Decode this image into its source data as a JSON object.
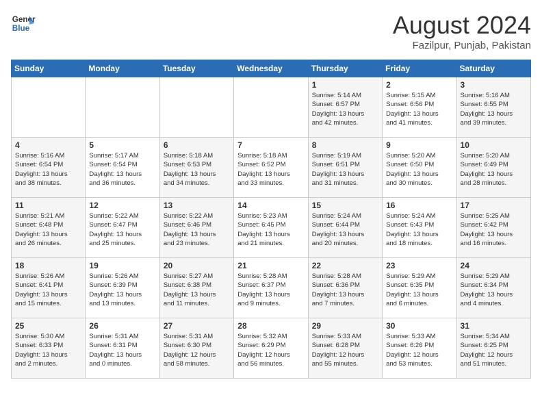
{
  "header": {
    "logo_line1": "General",
    "logo_line2": "Blue",
    "month": "August 2024",
    "location": "Fazilpur, Punjab, Pakistan"
  },
  "weekdays": [
    "Sunday",
    "Monday",
    "Tuesday",
    "Wednesday",
    "Thursday",
    "Friday",
    "Saturday"
  ],
  "weeks": [
    [
      {
        "day": "",
        "text": ""
      },
      {
        "day": "",
        "text": ""
      },
      {
        "day": "",
        "text": ""
      },
      {
        "day": "",
        "text": ""
      },
      {
        "day": "1",
        "text": "Sunrise: 5:14 AM\nSunset: 6:57 PM\nDaylight: 13 hours\nand 42 minutes."
      },
      {
        "day": "2",
        "text": "Sunrise: 5:15 AM\nSunset: 6:56 PM\nDaylight: 13 hours\nand 41 minutes."
      },
      {
        "day": "3",
        "text": "Sunrise: 5:16 AM\nSunset: 6:55 PM\nDaylight: 13 hours\nand 39 minutes."
      }
    ],
    [
      {
        "day": "4",
        "text": "Sunrise: 5:16 AM\nSunset: 6:54 PM\nDaylight: 13 hours\nand 38 minutes."
      },
      {
        "day": "5",
        "text": "Sunrise: 5:17 AM\nSunset: 6:54 PM\nDaylight: 13 hours\nand 36 minutes."
      },
      {
        "day": "6",
        "text": "Sunrise: 5:18 AM\nSunset: 6:53 PM\nDaylight: 13 hours\nand 34 minutes."
      },
      {
        "day": "7",
        "text": "Sunrise: 5:18 AM\nSunset: 6:52 PM\nDaylight: 13 hours\nand 33 minutes."
      },
      {
        "day": "8",
        "text": "Sunrise: 5:19 AM\nSunset: 6:51 PM\nDaylight: 13 hours\nand 31 minutes."
      },
      {
        "day": "9",
        "text": "Sunrise: 5:20 AM\nSunset: 6:50 PM\nDaylight: 13 hours\nand 30 minutes."
      },
      {
        "day": "10",
        "text": "Sunrise: 5:20 AM\nSunset: 6:49 PM\nDaylight: 13 hours\nand 28 minutes."
      }
    ],
    [
      {
        "day": "11",
        "text": "Sunrise: 5:21 AM\nSunset: 6:48 PM\nDaylight: 13 hours\nand 26 minutes."
      },
      {
        "day": "12",
        "text": "Sunrise: 5:22 AM\nSunset: 6:47 PM\nDaylight: 13 hours\nand 25 minutes."
      },
      {
        "day": "13",
        "text": "Sunrise: 5:22 AM\nSunset: 6:46 PM\nDaylight: 13 hours\nand 23 minutes."
      },
      {
        "day": "14",
        "text": "Sunrise: 5:23 AM\nSunset: 6:45 PM\nDaylight: 13 hours\nand 21 minutes."
      },
      {
        "day": "15",
        "text": "Sunrise: 5:24 AM\nSunset: 6:44 PM\nDaylight: 13 hours\nand 20 minutes."
      },
      {
        "day": "16",
        "text": "Sunrise: 5:24 AM\nSunset: 6:43 PM\nDaylight: 13 hours\nand 18 minutes."
      },
      {
        "day": "17",
        "text": "Sunrise: 5:25 AM\nSunset: 6:42 PM\nDaylight: 13 hours\nand 16 minutes."
      }
    ],
    [
      {
        "day": "18",
        "text": "Sunrise: 5:26 AM\nSunset: 6:41 PM\nDaylight: 13 hours\nand 15 minutes."
      },
      {
        "day": "19",
        "text": "Sunrise: 5:26 AM\nSunset: 6:39 PM\nDaylight: 13 hours\nand 13 minutes."
      },
      {
        "day": "20",
        "text": "Sunrise: 5:27 AM\nSunset: 6:38 PM\nDaylight: 13 hours\nand 11 minutes."
      },
      {
        "day": "21",
        "text": "Sunrise: 5:28 AM\nSunset: 6:37 PM\nDaylight: 13 hours\nand 9 minutes."
      },
      {
        "day": "22",
        "text": "Sunrise: 5:28 AM\nSunset: 6:36 PM\nDaylight: 13 hours\nand 7 minutes."
      },
      {
        "day": "23",
        "text": "Sunrise: 5:29 AM\nSunset: 6:35 PM\nDaylight: 13 hours\nand 6 minutes."
      },
      {
        "day": "24",
        "text": "Sunrise: 5:29 AM\nSunset: 6:34 PM\nDaylight: 13 hours\nand 4 minutes."
      }
    ],
    [
      {
        "day": "25",
        "text": "Sunrise: 5:30 AM\nSunset: 6:33 PM\nDaylight: 13 hours\nand 2 minutes."
      },
      {
        "day": "26",
        "text": "Sunrise: 5:31 AM\nSunset: 6:31 PM\nDaylight: 13 hours\nand 0 minutes."
      },
      {
        "day": "27",
        "text": "Sunrise: 5:31 AM\nSunset: 6:30 PM\nDaylight: 12 hours\nand 58 minutes."
      },
      {
        "day": "28",
        "text": "Sunrise: 5:32 AM\nSunset: 6:29 PM\nDaylight: 12 hours\nand 56 minutes."
      },
      {
        "day": "29",
        "text": "Sunrise: 5:33 AM\nSunset: 6:28 PM\nDaylight: 12 hours\nand 55 minutes."
      },
      {
        "day": "30",
        "text": "Sunrise: 5:33 AM\nSunset: 6:26 PM\nDaylight: 12 hours\nand 53 minutes."
      },
      {
        "day": "31",
        "text": "Sunrise: 5:34 AM\nSunset: 6:25 PM\nDaylight: 12 hours\nand 51 minutes."
      }
    ]
  ]
}
